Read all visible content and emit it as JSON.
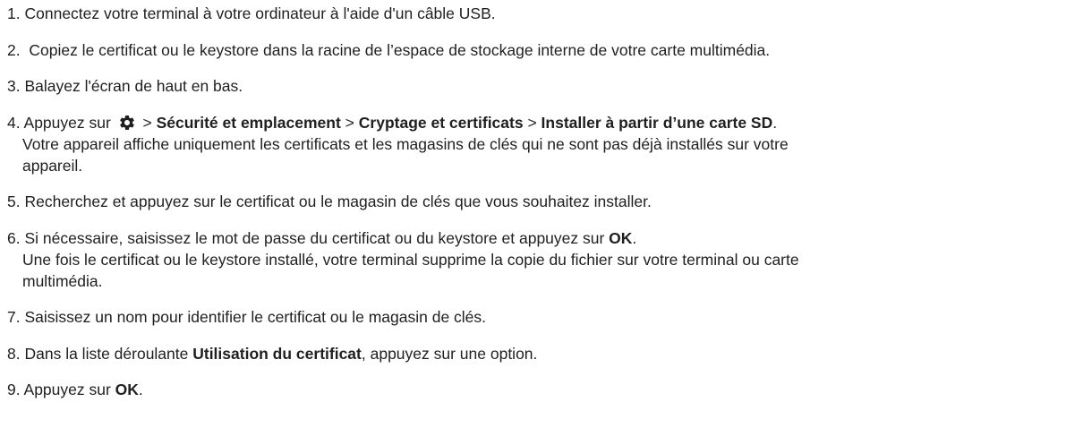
{
  "steps": [
    {
      "number": "1.",
      "text": "Connectez votre terminal à votre ordinateur à l'aide d'un câble USB."
    },
    {
      "number": "2.",
      "text": " Copiez le certificat ou le keystore dans la racine de l’espace de stockage interne de votre carte multimédia."
    },
    {
      "number": "3.",
      "text": "Balayez l'écran de haut en bas."
    },
    {
      "number": "4.",
      "prefix": "Appuyez sur ",
      "icon": "gear-icon",
      "sep1": " > ",
      "menu1": "Sécurité et emplacement",
      "sep2": " > ",
      "menu2": "Cryptage et certificats",
      "sep3": " > ",
      "menu3": "Installer à partir d’une carte SD",
      "end": ".",
      "detail_line1": "Votre appareil affiche uniquement les certificats et les magasins de clés qui ne sont pas déjà installés sur votre",
      "detail_line2": "appareil."
    },
    {
      "number": "5.",
      "text": "Recherchez et appuyez sur le certificat ou le magasin de clés que vous souhaitez installer."
    },
    {
      "number": "6.",
      "prefix": "Si nécessaire, saisissez le mot de passe du certificat ou du keystore et appuyez sur ",
      "bold": "OK",
      "end": ".",
      "detail_line1": "Une fois le certificat ou le keystore installé, votre terminal supprime la copie du fichier sur votre terminal ou carte",
      "detail_line2": "multimédia."
    },
    {
      "number": "7.",
      "text": "Saisissez un nom pour identifier le certificat ou le magasin de clés."
    },
    {
      "number": "8.",
      "prefix": "Dans la liste déroulante ",
      "bold": "Utilisation du certificat",
      "end": ", appuyez sur une option."
    },
    {
      "number": "9.",
      "prefix": "Appuyez sur ",
      "bold": "OK",
      "end": "."
    }
  ]
}
